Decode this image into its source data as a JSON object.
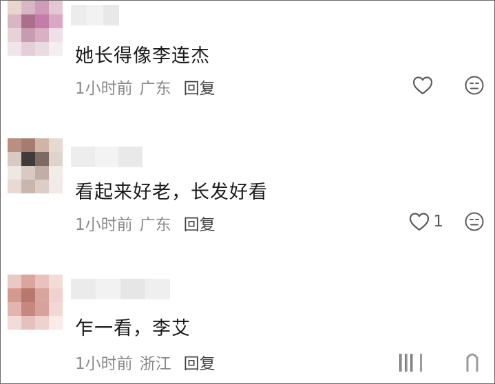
{
  "comments": [
    {
      "text": "她长得像李连杰",
      "time": "1小时前",
      "location": "广东",
      "reply_label": "回复",
      "like_count": "",
      "avatar_colors": [
        "#e8d6cc",
        "#d7b7c6",
        "#cf9bb9",
        "#e3c7d2",
        "#d8b6c4",
        "#ab6f8c",
        "#c47da8",
        "#d9a8c4",
        "#e6d3d8",
        "#c79bb0",
        "#d8b1c2",
        "#efdfe6",
        "#f0e5ea",
        "#e4cfd9",
        "#eadbe1",
        "#f5eef1"
      ],
      "name_blocks": [
        "#ececec",
        "#f2f2f2",
        "#e8e8e8"
      ]
    },
    {
      "text": "看起来好老，长发好看",
      "time": "1小时前",
      "location": "广东",
      "reply_label": "回复",
      "like_count": "1",
      "avatar_colors": [
        "#b98f82",
        "#a67c70",
        "#cfb4a8",
        "#e6d9d1",
        "#d7c9c3",
        "#3f3b39",
        "#7d6a63",
        "#e0d3cc",
        "#efe7e2",
        "#d8c9c2",
        "#c2aea6",
        "#f2ece8",
        "#e7d9d3",
        "#c9b6ad",
        "#dccdc6",
        "#f1ebe7"
      ],
      "name_blocks": [
        "#ededed",
        "#f3f3f3",
        "#e9e9e9"
      ]
    },
    {
      "text": "乍一看，李艾",
      "time": "1小时前",
      "location": "浙江",
      "reply_label": "回复",
      "like_count": "",
      "avatar_colors": [
        "#e9c9c3",
        "#d9a59e",
        "#e8c3bd",
        "#f3dcd8",
        "#d49a92",
        "#b8776f",
        "#d8a49c",
        "#efd2cd",
        "#e2b6b0",
        "#c58880",
        "#d7a29b",
        "#f2d8d4",
        "#f1dcd8",
        "#e4c1bc",
        "#edd2ce",
        "#f8ebe9"
      ],
      "name_blocks": [
        "#ebebeb",
        "#f2f2f2",
        "#e6e6e6",
        "#efefef"
      ]
    }
  ],
  "icons": {
    "like": "heart-outline-icon",
    "emoji": "neutral-face-icon"
  },
  "colors": {
    "text": "#1a1a1a",
    "meta": "#8a8a8a",
    "icon": "#555555",
    "border": "#6a6a6a"
  }
}
